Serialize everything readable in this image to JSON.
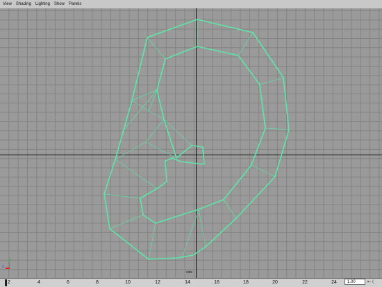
{
  "menu": [
    "View",
    "Shading",
    "Lighting",
    "Show",
    "Panels"
  ],
  "viewport": {
    "camera_label": "side",
    "background_color": "#9a9a9a",
    "grid_color": "#838383",
    "axis_color": "#111111",
    "wire_color": "#5ce6a8"
  },
  "gizmo": {
    "y_label": "y",
    "z_label": "z"
  },
  "timeline": {
    "ticks": [
      "2",
      "4",
      "6",
      "8",
      "10",
      "12",
      "14",
      "16",
      "18",
      "20",
      "22",
      "24"
    ],
    "current_frame": "1.00",
    "step_glyph": "⇤ ⟨"
  }
}
